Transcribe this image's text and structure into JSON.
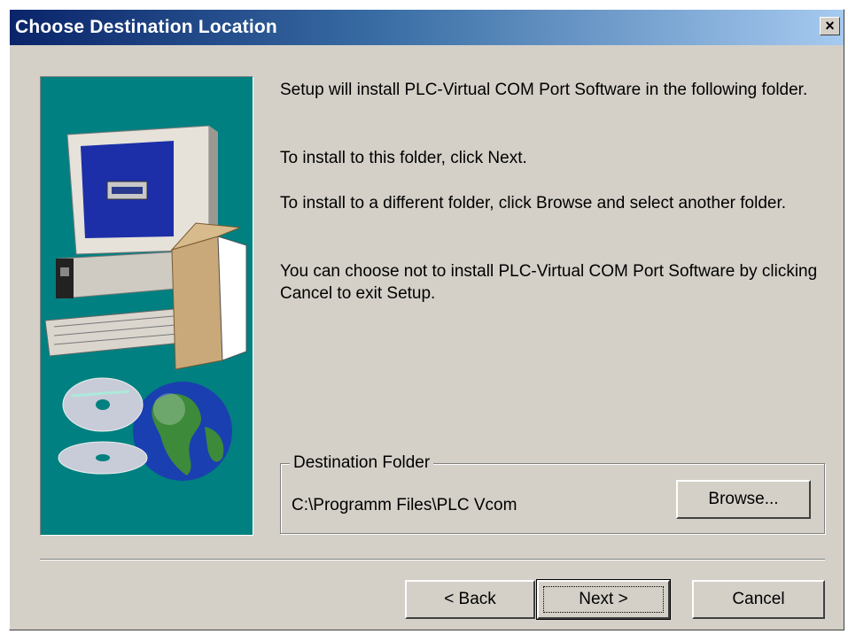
{
  "window": {
    "title": "Choose Destination Location",
    "close_label": "×"
  },
  "messages": [
    "Setup will install PLC-Virtual COM Port Software in the following folder.",
    "To install to this folder, click Next.",
    "To install to a different folder, click Browse and select another folder.",
    "You can choose not to install PLC-Virtual COM Port Software by clicking Cancel to exit Setup."
  ],
  "destination": {
    "legend": "Destination Folder",
    "path": "C:\\Programm Files\\PLC Vcom",
    "browse_label": "Browse..."
  },
  "buttons": {
    "back_label": "< Back",
    "next_label": "Next >",
    "cancel_label": "Cancel"
  },
  "colors": {
    "art_background": "#008080",
    "dialog_face": "#d4d0c8",
    "title_start": "#0a246a",
    "title_end": "#a6caf0"
  }
}
